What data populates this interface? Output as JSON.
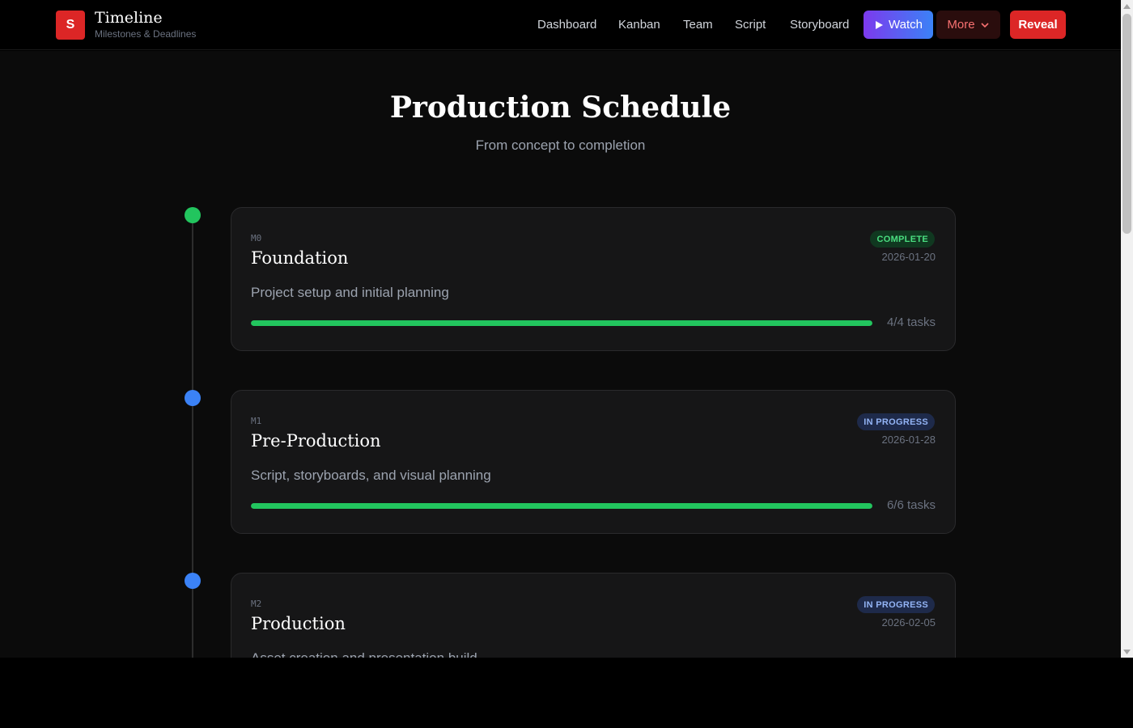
{
  "header": {
    "logo_letter": "S",
    "title": "Timeline",
    "subtitle": "Milestones & Deadlines",
    "nav": [
      "Dashboard",
      "Kanban",
      "Team",
      "Script",
      "Storyboard"
    ],
    "watch_label": "Watch",
    "more_label": "More",
    "reveal_label": "Reveal"
  },
  "page": {
    "title": "Production Schedule",
    "subtitle": "From concept to completion"
  },
  "milestones": [
    {
      "code": "M0",
      "title": "Foundation",
      "description": "Project setup and initial planning",
      "status": "COMPLETE",
      "date": "2026-01-20",
      "tasks_label": "4/4 tasks",
      "progress": 1.0,
      "dot_color": "#22c55e"
    },
    {
      "code": "M1",
      "title": "Pre-Production",
      "description": "Script, storyboards, and visual planning",
      "status": "IN PROGRESS",
      "date": "2026-01-28",
      "tasks_label": "6/6 tasks",
      "progress": 1.0,
      "dot_color": "#3b82f6"
    },
    {
      "code": "M2",
      "title": "Production",
      "description": "Asset creation and presentation build",
      "status": "IN PROGRESS",
      "date": "2026-02-05",
      "dot_color": "#3b82f6"
    }
  ]
}
